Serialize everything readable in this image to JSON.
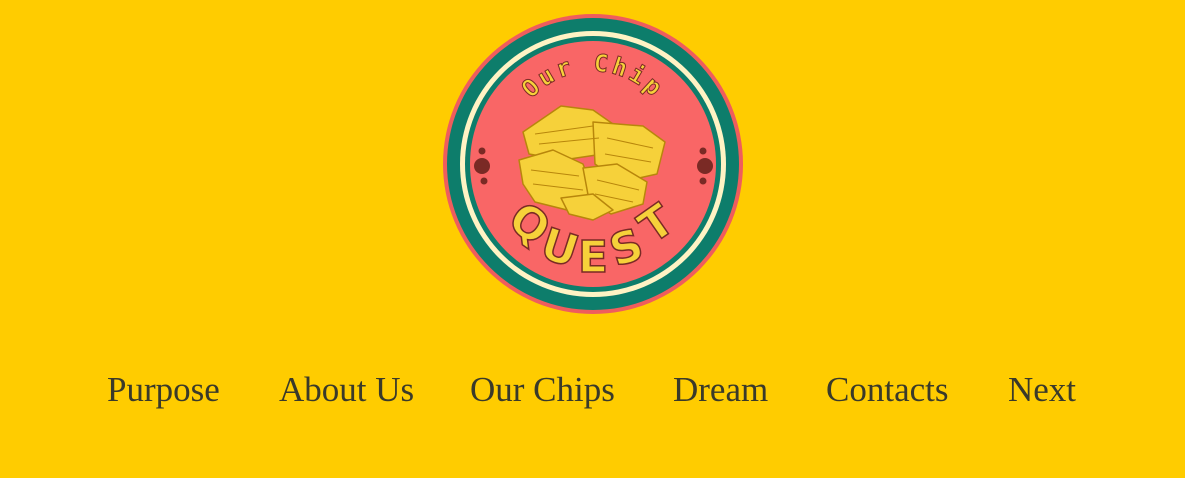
{
  "logo": {
    "top_text": "Our Chip",
    "bottom_letters": [
      "Q",
      "U",
      "E",
      "S",
      "T"
    ],
    "colors": {
      "outer_ring": "#ef5d5d",
      "teal_ring": "#0d7d6b",
      "cream_ring": "#fff3c4",
      "inner_disc": "#f96666",
      "chip_fill": "#f6d13a",
      "chip_stroke": "#b8860b",
      "dots": "#7a2a25"
    },
    "icon": "potato-chips-pile-icon"
  },
  "nav": {
    "items": [
      {
        "label": "Purpose"
      },
      {
        "label": "About Us"
      },
      {
        "label": "Our Chips"
      },
      {
        "label": "Dream"
      },
      {
        "label": "Contacts"
      },
      {
        "label": "Next"
      }
    ]
  },
  "colors": {
    "background": "#ffcc00",
    "nav_text": "#3a3a2a"
  }
}
